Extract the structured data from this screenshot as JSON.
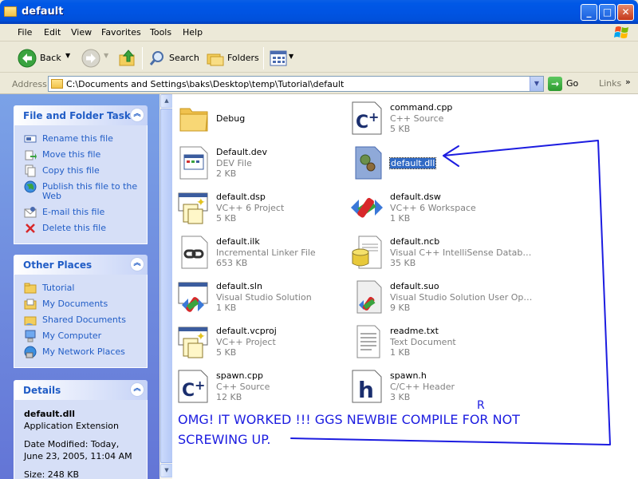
{
  "window": {
    "title": "default"
  },
  "menu": [
    "File",
    "Edit",
    "View",
    "Favorites",
    "Tools",
    "Help"
  ],
  "toolbar": {
    "back": "Back",
    "search": "Search",
    "folders": "Folders"
  },
  "address": {
    "label": "Address",
    "value": "C:\\Documents and Settings\\baks\\Desktop\\temp\\Tutorial\\default",
    "go": "Go",
    "links": "Links"
  },
  "tasks": {
    "title": "File and Folder Tasks",
    "items": [
      "Rename this file",
      "Move this file",
      "Copy this file",
      "Publish this file to the Web",
      "E-mail this file",
      "Delete this file"
    ]
  },
  "other_places": {
    "title": "Other Places",
    "items": [
      "Tutorial",
      "My Documents",
      "Shared Documents",
      "My Computer",
      "My Network Places"
    ]
  },
  "details": {
    "title": "Details",
    "name": "default.dll",
    "type": "Application Extension",
    "modified": "Date Modified: Today, June 23, 2005, 11:04 AM",
    "size": "Size: 248 KB"
  },
  "files": [
    {
      "name": "Debug",
      "type": "",
      "size": "",
      "icon": "folder-icon"
    },
    {
      "name": "command.cpp",
      "type": "C++ Source",
      "size": "5 KB",
      "icon": "cpp-source-icon"
    },
    {
      "name": "Default.dev",
      "type": "DEV File",
      "size": "2 KB",
      "icon": "dev-file-icon"
    },
    {
      "name": "default.dll",
      "type": "",
      "size": "",
      "icon": "dll-file-icon",
      "selected": true
    },
    {
      "name": "default.dsp",
      "type": "VC++ 6 Project",
      "size": "5 KB",
      "icon": "vc-project-icon"
    },
    {
      "name": "default.dsw",
      "type": "VC++ 6 Workspace",
      "size": "1 KB",
      "icon": "vc-workspace-icon"
    },
    {
      "name": "default.ilk",
      "type": "Incremental Linker File",
      "size": "653 KB",
      "icon": "linker-file-icon"
    },
    {
      "name": "default.ncb",
      "type": "Visual C++ IntelliSense Datab…",
      "size": "35 KB",
      "icon": "intellisense-db-icon"
    },
    {
      "name": "default.sln",
      "type": "Visual Studio Solution",
      "size": "1 KB",
      "icon": "vs-solution-icon"
    },
    {
      "name": "default.suo",
      "type": "Visual Studio Solution User Op…",
      "size": "9 KB",
      "icon": "vs-user-options-icon"
    },
    {
      "name": "default.vcproj",
      "type": "VC++ Project",
      "size": "5 KB",
      "icon": "vc-project-icon"
    },
    {
      "name": "readme.txt",
      "type": "Text Document",
      "size": "1 KB",
      "icon": "text-document-icon"
    },
    {
      "name": "spawn.cpp",
      "type": "C++ Source",
      "size": "12 KB",
      "icon": "cpp-source-icon"
    },
    {
      "name": "spawn.h",
      "type": "C/C++ Header",
      "size": "3 KB",
      "icon": "c-header-icon"
    }
  ],
  "annotation": {
    "line1": "OMG! IT WORKED !!! GGS NEWBIE COMPILE FOR NOT",
    "line2": "SCREWING UP.",
    "mark": "R",
    "color": "#1C1CE0"
  }
}
